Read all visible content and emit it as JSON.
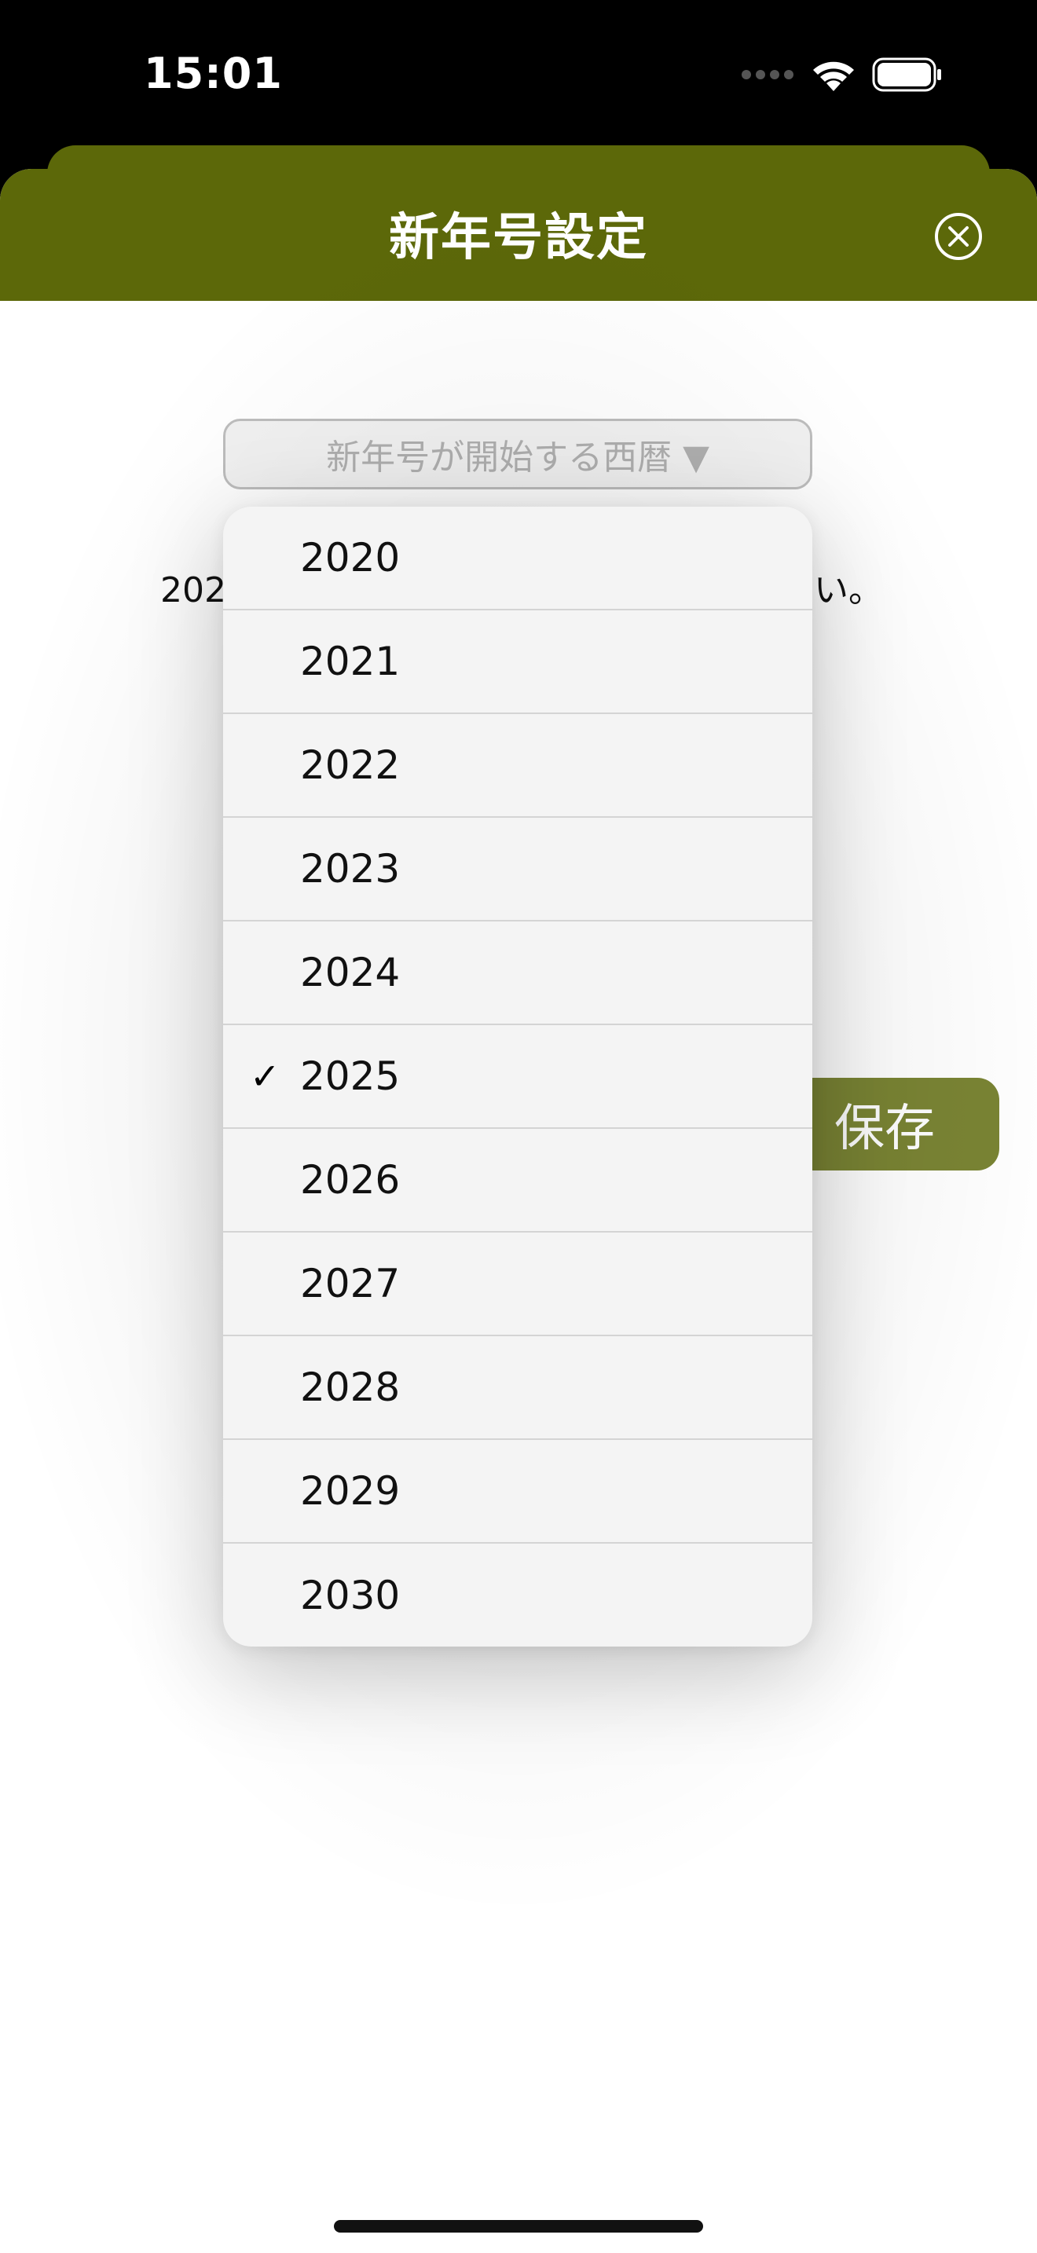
{
  "status_bar": {
    "time": "15:01",
    "icons": [
      "signal-dots-icon",
      "wifi-icon",
      "battery-icon"
    ]
  },
  "sheet": {
    "title": "新年号設定",
    "header_color": "#5c6809",
    "close_icon": "close-circle-icon"
  },
  "picker": {
    "label": "新年号が開始する西暦 ▼"
  },
  "description": {
    "prefix": "202",
    "suffix": "い。"
  },
  "save_button": {
    "label": "保存",
    "color": "#7a8434"
  },
  "menu": {
    "items": [
      {
        "label": "2020",
        "checked": false
      },
      {
        "label": "2021",
        "checked": false
      },
      {
        "label": "2022",
        "checked": false
      },
      {
        "label": "2023",
        "checked": false
      },
      {
        "label": "2024",
        "checked": false
      },
      {
        "label": "2025",
        "checked": true
      },
      {
        "label": "2026",
        "checked": false
      },
      {
        "label": "2027",
        "checked": false
      },
      {
        "label": "2028",
        "checked": false
      },
      {
        "label": "2029",
        "checked": false
      },
      {
        "label": "2030",
        "checked": false
      }
    ],
    "check_glyph": "✓"
  }
}
